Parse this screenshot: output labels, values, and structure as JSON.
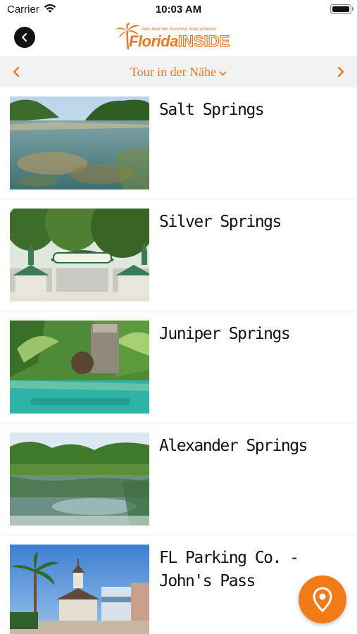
{
  "status_bar": {
    "carrier": "Carrier",
    "time": "10:03 AM"
  },
  "header": {
    "logo_tagline": "Alles über den Sunshine State erfahren!",
    "logo_word_1": "Florida",
    "logo_word_2": "INSIDE",
    "brand_color": "#e87722"
  },
  "tour_bar": {
    "title": "Tour in der Nähe"
  },
  "places": [
    {
      "title": "Salt Springs"
    },
    {
      "title": "Silver Springs"
    },
    {
      "title": "Juniper Springs"
    },
    {
      "title": "Alexander Springs"
    },
    {
      "title": "FL Parking Co. - John's Pass"
    }
  ],
  "icons": {
    "back": "chevron-left-icon",
    "prev": "chevron-left-icon",
    "next": "chevron-right-icon",
    "dropdown": "chevron-down-icon",
    "map": "map-pin-icon",
    "wifi": "wifi-icon",
    "battery": "battery-icon"
  }
}
